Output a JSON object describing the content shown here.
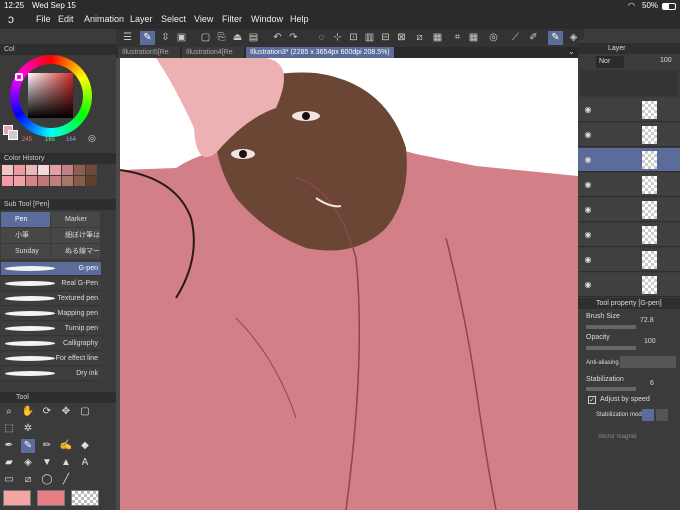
{
  "status": {
    "time": "12:25",
    "date": "Wed Sep 15",
    "battery": "50%"
  },
  "menu": [
    "File",
    "Edit",
    "Animation",
    "Layer",
    "Select",
    "View",
    "Filter",
    "Window",
    "Help"
  ],
  "tabs": [
    {
      "label": "Illustration5[Re"
    },
    {
      "label": "Illustration4[Re"
    },
    {
      "label": "Illustration3* (2285 x 3654px 600dpi 208.5%)"
    }
  ],
  "color_panel": {
    "tab": "Col",
    "values": [
      "245",
      "165",
      "164"
    ],
    "main_color": "#f3a5a4",
    "sub_color": "#e87d85"
  },
  "color_history": {
    "title": "Color History",
    "swatches": [
      "#f4c3c4",
      "#ee9aa0",
      "#f0b7bb",
      "#f2d9da",
      "#e69ea4",
      "#c57e84",
      "#8f5c4d",
      "#6f4a39",
      "#f29aa5",
      "#f0a2a6",
      "#d48388",
      "#c07577",
      "#be8078",
      "#a7776c",
      "#8a5b45",
      "#5f3e2e"
    ]
  },
  "sub_tool": {
    "title": "Sub Tool [Pen]",
    "groups": [
      "Pen",
      "Marker",
      "小筆",
      "細ぼけ筆は",
      "Sunday",
      "ぬる線マーカ"
    ],
    "brushes": [
      "G-pen",
      "Real G-Pen",
      "Textured pen",
      "Mapping pen",
      "Turnip pen",
      "Calligraphy",
      "For effect line",
      "Dry ink"
    ]
  },
  "tool_panel": {
    "title": "Tool"
  },
  "layer_panel": {
    "title": "Layer",
    "blend": "Nor",
    "opacity": "100"
  },
  "tool_property": {
    "title": "Tool property [G-pen]",
    "brush_size_label": "Brush Size",
    "brush_size": "72.8",
    "opacity_label": "Opacity",
    "opacity": "100",
    "antialias_label": "Anti-aliasing",
    "stabilization_label": "Stabilization",
    "stabilization": "6",
    "adjust_speed_label": "Adjust by speed",
    "stab_mode_label": "Stabilization mode",
    "vector_magnet_label": "Vector magnet"
  },
  "colors": {
    "accent": "#5b6b9a",
    "shirt": "#d27f88",
    "skin": "#6b4634",
    "hat": "#edb1b4"
  }
}
